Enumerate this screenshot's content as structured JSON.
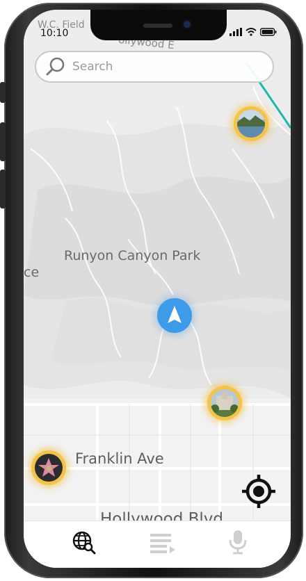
{
  "status_bar": {
    "time": "10:10"
  },
  "search": {
    "placeholder": "Search"
  },
  "map": {
    "labels": {
      "top_partial": "W.C. Field",
      "top_partial_road": "ollywood E",
      "park": "Runyon Canyon Park",
      "left_partial": "ce",
      "street_1": "Franklin Ave",
      "street_2": "Hollywood Blvd"
    }
  },
  "tabbar": {
    "tabs": [
      {
        "icon": "globe-search-icon",
        "active": true
      },
      {
        "icon": "list-play-icon",
        "active": false
      },
      {
        "icon": "microphone-icon",
        "active": false
      }
    ]
  },
  "colors": {
    "accent_blue": "#3d9be9",
    "marker_gold": "#f3c34a",
    "teal_line": "#1fb8a6"
  }
}
